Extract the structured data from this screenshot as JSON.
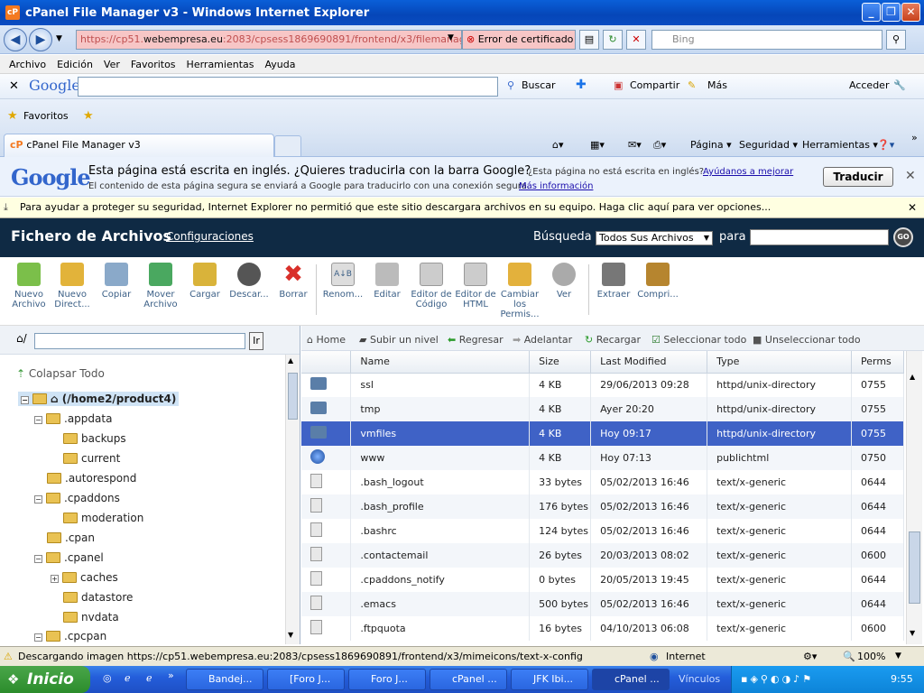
{
  "window": {
    "title": "cPanel File Manager v3 - Windows Internet Explorer"
  },
  "address": {
    "url_prefix": "https://cp51.",
    "url_host": "webempresa.eu",
    "url_suffix": ":2083/cpsess1869690891/frontend/x3/filemanag",
    "cert_error": "Error de certificado",
    "search_placeholder": "Bing"
  },
  "menu": [
    "Archivo",
    "Edición",
    "Ver",
    "Favoritos",
    "Herramientas",
    "Ayuda"
  ],
  "google_toolbar": {
    "logo": "Google",
    "search": "Buscar",
    "share": "Compartir",
    "more": "Más",
    "signin": "Acceder"
  },
  "favorites": {
    "label": "Favoritos"
  },
  "tab": {
    "title": "cPanel File Manager v3"
  },
  "commands": {
    "page": "Página",
    "security": "Seguridad",
    "tools": "Herramientas"
  },
  "translate": {
    "logo": "Google",
    "main": "Esta página está escrita en inglés. ¿Quieres traducirla con la barra Google?",
    "not_english": "¿Esta página no está escrita en inglés?",
    "help_link": "Ayúdanos a mejorar",
    "line2": "El contenido de esta página segura se enviará a Google para traducirlo con una conexión segura.",
    "more_info": "Más información",
    "button": "Traducir"
  },
  "infobar": {
    "text": "Para ayudar a proteger su seguridad, Internet Explorer no permitió que este sitio descargara archivos en su equipo. Haga clic aquí para ver opciones..."
  },
  "cpanel": {
    "title": "Fichero de Archivos",
    "settings": "Configuraciones",
    "search_label": "Búsqueda",
    "search_scope": "Todos Sus Archivos",
    "para": "para",
    "go": "GO"
  },
  "toolbar": [
    {
      "label": "Nuevo Archivo",
      "color": "#7bbf4a"
    },
    {
      "label": "Nuevo Direct...",
      "color": "#e2b33a"
    },
    {
      "label": "Copiar",
      "color": "#8aa9c9"
    },
    {
      "label": "Mover Archivo",
      "color": "#4aa860"
    },
    {
      "label": "Cargar",
      "color": "#d9b33a"
    },
    {
      "label": "Descar...",
      "color": "#555555"
    },
    {
      "label": "Borrar",
      "color": "#d9302a"
    },
    {
      "label": "Renom...",
      "color": "#dddddd"
    },
    {
      "label": "Editar",
      "color": "#bbbbbb"
    },
    {
      "label": "Editor de Código",
      "color": "#cccccc"
    },
    {
      "label": "Editor de HTML",
      "color": "#cccccc"
    },
    {
      "label": "Cambiar los Permis...",
      "color": "#e3b13c"
    },
    {
      "label": "Ver",
      "color": "#aaaaaa"
    },
    {
      "label": "Extraer",
      "color": "#777777"
    },
    {
      "label": "Compri...",
      "color": "#b6852f"
    }
  ],
  "tree": {
    "collapse": "Colapsar Todo",
    "root": "(/home2/product4)",
    "items": [
      ".appdata",
      "backups",
      "current",
      ".autorespond",
      ".cpaddons",
      "moderation",
      ".cpan",
      ".cpanel",
      "caches",
      "datastore",
      "nvdata",
      ".cpcpan"
    ]
  },
  "nav": {
    "home": "Home",
    "up": "Subir un nivel",
    "back": "Regresar",
    "forward": "Adelantar",
    "reload": "Recargar",
    "select_all": "Seleccionar todo",
    "deselect_all": "Unseleccionar todo"
  },
  "columns": [
    "Name",
    "Size",
    "Last Modified",
    "Type",
    "Perms"
  ],
  "files": [
    {
      "name": "ssl",
      "size": "4 KB",
      "modified": "29/06/2013 09:28",
      "type": "httpd/unix-directory",
      "perms": "0755",
      "kind": "dir"
    },
    {
      "name": "tmp",
      "size": "4 KB",
      "modified": "Ayer 20:20",
      "type": "httpd/unix-directory",
      "perms": "0755",
      "kind": "dir"
    },
    {
      "name": "vmfiles",
      "size": "4 KB",
      "modified": "Hoy 09:17",
      "type": "httpd/unix-directory",
      "perms": "0755",
      "kind": "dir",
      "selected": true
    },
    {
      "name": "www",
      "size": "4 KB",
      "modified": "Hoy 07:13",
      "type": "publichtml",
      "perms": "0750",
      "kind": "web"
    },
    {
      "name": ".bash_logout",
      "size": "33 bytes",
      "modified": "05/02/2013 16:46",
      "type": "text/x-generic",
      "perms": "0644",
      "kind": "doc"
    },
    {
      "name": ".bash_profile",
      "size": "176 bytes",
      "modified": "05/02/2013 16:46",
      "type": "text/x-generic",
      "perms": "0644",
      "kind": "doc"
    },
    {
      "name": ".bashrc",
      "size": "124 bytes",
      "modified": "05/02/2013 16:46",
      "type": "text/x-generic",
      "perms": "0644",
      "kind": "doc"
    },
    {
      "name": ".contactemail",
      "size": "26 bytes",
      "modified": "20/03/2013 08:02",
      "type": "text/x-generic",
      "perms": "0600",
      "kind": "doc"
    },
    {
      "name": ".cpaddons_notify",
      "size": "0 bytes",
      "modified": "20/05/2013 19:45",
      "type": "text/x-generic",
      "perms": "0644",
      "kind": "doc"
    },
    {
      "name": ".emacs",
      "size": "500 bytes",
      "modified": "05/02/2013 16:46",
      "type": "text/x-generic",
      "perms": "0644",
      "kind": "doc"
    },
    {
      "name": ".ftpquota",
      "size": "16 bytes",
      "modified": "04/10/2013 06:08",
      "type": "text/x-generic",
      "perms": "0600",
      "kind": "doc"
    }
  ],
  "status": {
    "text": "Descargando imagen https://cp51.webempresa.eu:2083/cpsess1869690891/frontend/x3/mimeicons/text-x-config",
    "zone": "Internet",
    "zoom": "100%"
  },
  "taskbar": {
    "start": "Inicio",
    "tasks": [
      "Bandej...",
      "[Foro J...",
      "Foro J...",
      "cPanel ...",
      "JFK Ibi...",
      "cPanel ..."
    ],
    "links": "Vínculos",
    "clock": "9:55"
  }
}
